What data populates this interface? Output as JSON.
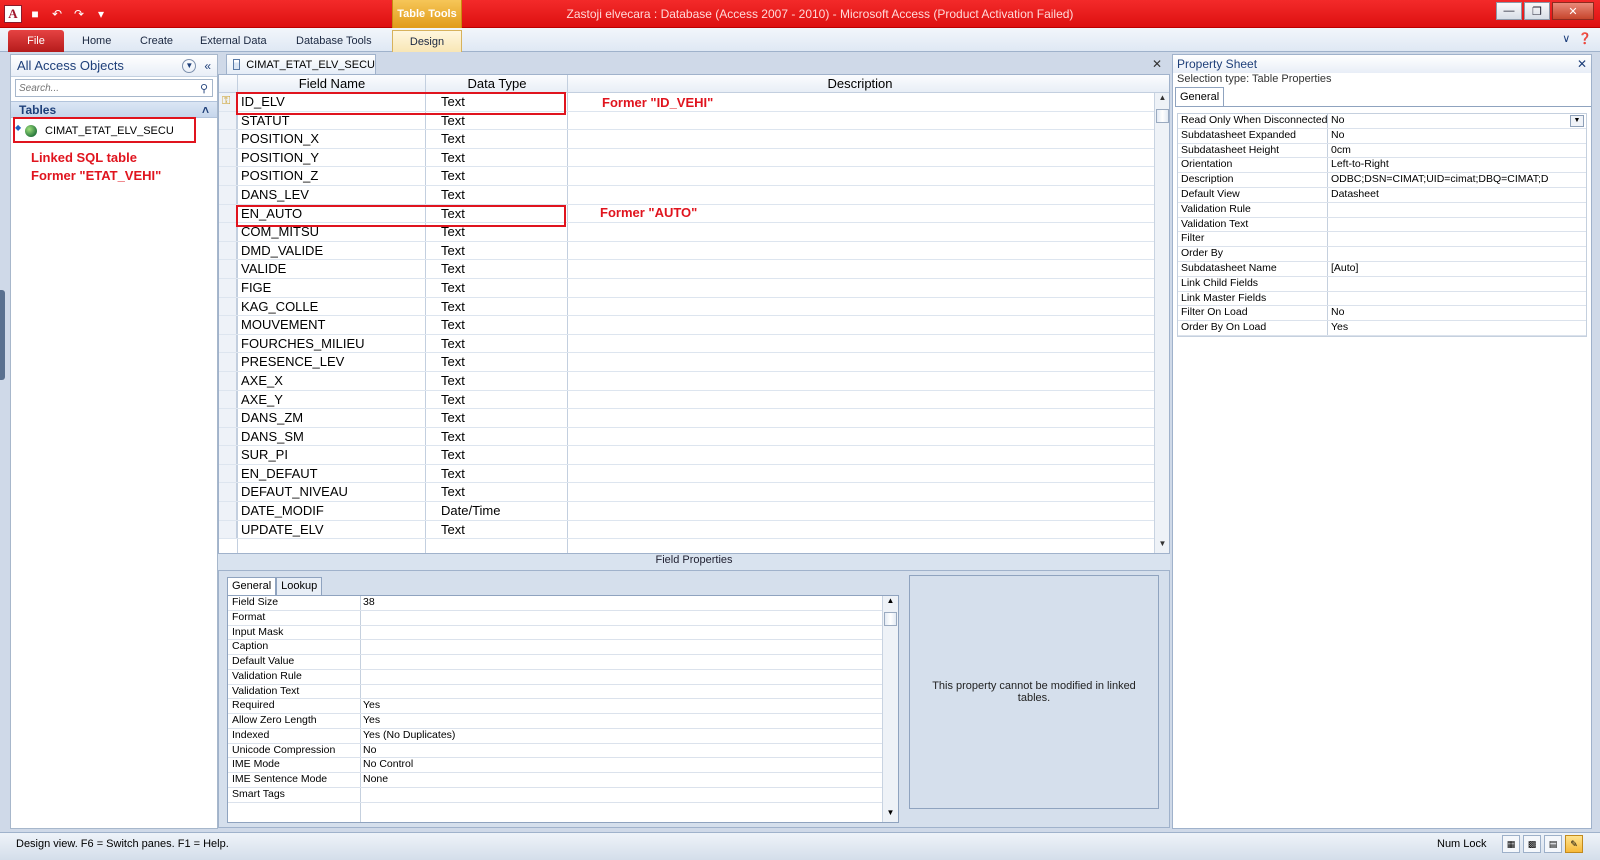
{
  "window": {
    "title": "Zastoji elvecara : Database (Access 2007 - 2010)  -  Microsoft Access (Product Activation Failed)",
    "context_tab": "Table Tools"
  },
  "ribbon": {
    "tabs": [
      "File",
      "Home",
      "Create",
      "External Data",
      "Database Tools",
      "Design"
    ]
  },
  "nav": {
    "title": "All Access Objects",
    "search_placeholder": "Search...",
    "group": "Tables",
    "items": [
      {
        "label": "CIMAT_ETAT_ELV_SECU"
      }
    ]
  },
  "annotations": {
    "nav_note_line1": "Linked SQL table",
    "nav_note_line2": "Former \"ETAT_VEHI\"",
    "id_note": "Former \"ID_VEHI\"",
    "auto_note": "Former \"AUTO\""
  },
  "document": {
    "tab": "CIMAT_ETAT_ELV_SECU",
    "headers": {
      "field": "Field Name",
      "type": "Data Type",
      "desc": "Description"
    },
    "fields": [
      {
        "name": "ID_ELV",
        "type": "Text"
      },
      {
        "name": "STATUT",
        "type": "Text"
      },
      {
        "name": "POSITION_X",
        "type": "Text"
      },
      {
        "name": "POSITION_Y",
        "type": "Text"
      },
      {
        "name": "POSITION_Z",
        "type": "Text"
      },
      {
        "name": "DANS_LEV",
        "type": "Text"
      },
      {
        "name": "EN_AUTO",
        "type": "Text"
      },
      {
        "name": "COM_MITSU",
        "type": "Text"
      },
      {
        "name": "DMD_VALIDE",
        "type": "Text"
      },
      {
        "name": "VALIDE",
        "type": "Text"
      },
      {
        "name": "FIGE",
        "type": "Text"
      },
      {
        "name": "KAG_COLLE",
        "type": "Text"
      },
      {
        "name": "MOUVEMENT",
        "type": "Text"
      },
      {
        "name": "FOURCHES_MILIEU",
        "type": "Text"
      },
      {
        "name": "PRESENCE_LEV",
        "type": "Text"
      },
      {
        "name": "AXE_X",
        "type": "Text"
      },
      {
        "name": "AXE_Y",
        "type": "Text"
      },
      {
        "name": "DANS_ZM",
        "type": "Text"
      },
      {
        "name": "DANS_SM",
        "type": "Text"
      },
      {
        "name": "SUR_PI",
        "type": "Text"
      },
      {
        "name": "EN_DEFAUT",
        "type": "Text"
      },
      {
        "name": "DEFAUT_NIVEAU",
        "type": "Text"
      },
      {
        "name": "DATE_MODIF",
        "type": "Date/Time"
      },
      {
        "name": "UPDATE_ELV",
        "type": "Text"
      }
    ]
  },
  "field_properties": {
    "label": "Field Properties",
    "tabs": [
      "General",
      "Lookup"
    ],
    "rows": [
      {
        "k": "Field Size",
        "v": "38"
      },
      {
        "k": "Format",
        "v": ""
      },
      {
        "k": "Input Mask",
        "v": ""
      },
      {
        "k": "Caption",
        "v": ""
      },
      {
        "k": "Default Value",
        "v": ""
      },
      {
        "k": "Validation Rule",
        "v": ""
      },
      {
        "k": "Validation Text",
        "v": ""
      },
      {
        "k": "Required",
        "v": "Yes"
      },
      {
        "k": "Allow Zero Length",
        "v": "Yes"
      },
      {
        "k": "Indexed",
        "v": "Yes (No Duplicates)"
      },
      {
        "k": "Unicode Compression",
        "v": "No"
      },
      {
        "k": "IME Mode",
        "v": "No Control"
      },
      {
        "k": "IME Sentence Mode",
        "v": "None"
      },
      {
        "k": "Smart Tags",
        "v": ""
      }
    ],
    "help": "This property cannot be modified in linked tables."
  },
  "property_sheet": {
    "title": "Property Sheet",
    "selection_type": "Selection type:  Table Properties",
    "tab": "General",
    "rows": [
      {
        "k": "Read Only When Disconnected",
        "v": "No"
      },
      {
        "k": "Subdatasheet Expanded",
        "v": "No"
      },
      {
        "k": "Subdatasheet Height",
        "v": "0cm"
      },
      {
        "k": "Orientation",
        "v": "Left-to-Right"
      },
      {
        "k": "Description",
        "v": "ODBC;DSN=CIMAT;UID=cimat;DBQ=CIMAT;D"
      },
      {
        "k": "Default View",
        "v": "Datasheet"
      },
      {
        "k": "Validation Rule",
        "v": ""
      },
      {
        "k": "Validation Text",
        "v": ""
      },
      {
        "k": "Filter",
        "v": ""
      },
      {
        "k": "Order By",
        "v": ""
      },
      {
        "k": "Subdatasheet Name",
        "v": "[Auto]"
      },
      {
        "k": "Link Child Fields",
        "v": ""
      },
      {
        "k": "Link Master Fields",
        "v": ""
      },
      {
        "k": "Filter On Load",
        "v": "No"
      },
      {
        "k": "Order By On Load",
        "v": "Yes"
      }
    ]
  },
  "status": {
    "message": "Design view.  F6 = Switch panes.  F1 = Help.",
    "num_lock": "Num Lock"
  },
  "colors": {
    "title_red": "#e21515",
    "annotation_red": "#e0141e",
    "context_orange": "#e9a520"
  }
}
